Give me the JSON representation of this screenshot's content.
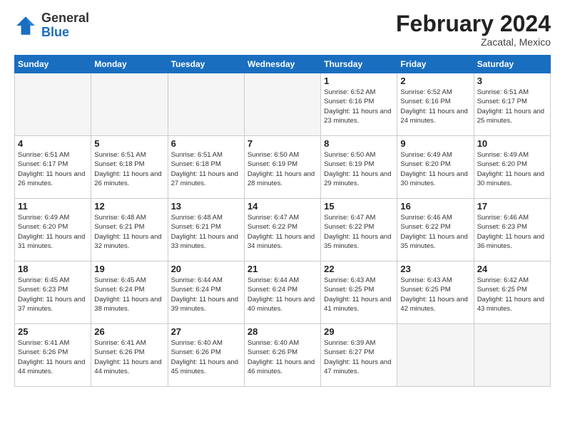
{
  "header": {
    "logo_general": "General",
    "logo_blue": "Blue",
    "month_year": "February 2024",
    "location": "Zacatal, Mexico"
  },
  "weekdays": [
    "Sunday",
    "Monday",
    "Tuesday",
    "Wednesday",
    "Thursday",
    "Friday",
    "Saturday"
  ],
  "weeks": [
    [
      {
        "day": "",
        "empty": true
      },
      {
        "day": "",
        "empty": true
      },
      {
        "day": "",
        "empty": true
      },
      {
        "day": "",
        "empty": true
      },
      {
        "day": "1",
        "sunrise": "6:52 AM",
        "sunset": "6:16 PM",
        "daylight": "11 hours and 23 minutes."
      },
      {
        "day": "2",
        "sunrise": "6:52 AM",
        "sunset": "6:16 PM",
        "daylight": "11 hours and 24 minutes."
      },
      {
        "day": "3",
        "sunrise": "6:51 AM",
        "sunset": "6:17 PM",
        "daylight": "11 hours and 25 minutes."
      }
    ],
    [
      {
        "day": "4",
        "sunrise": "6:51 AM",
        "sunset": "6:17 PM",
        "daylight": "11 hours and 26 minutes."
      },
      {
        "day": "5",
        "sunrise": "6:51 AM",
        "sunset": "6:18 PM",
        "daylight": "11 hours and 26 minutes."
      },
      {
        "day": "6",
        "sunrise": "6:51 AM",
        "sunset": "6:18 PM",
        "daylight": "11 hours and 27 minutes."
      },
      {
        "day": "7",
        "sunrise": "6:50 AM",
        "sunset": "6:19 PM",
        "daylight": "11 hours and 28 minutes."
      },
      {
        "day": "8",
        "sunrise": "6:50 AM",
        "sunset": "6:19 PM",
        "daylight": "11 hours and 29 minutes."
      },
      {
        "day": "9",
        "sunrise": "6:49 AM",
        "sunset": "6:20 PM",
        "daylight": "11 hours and 30 minutes."
      },
      {
        "day": "10",
        "sunrise": "6:49 AM",
        "sunset": "6:20 PM",
        "daylight": "11 hours and 30 minutes."
      }
    ],
    [
      {
        "day": "11",
        "sunrise": "6:49 AM",
        "sunset": "6:20 PM",
        "daylight": "11 hours and 31 minutes."
      },
      {
        "day": "12",
        "sunrise": "6:48 AM",
        "sunset": "6:21 PM",
        "daylight": "11 hours and 32 minutes."
      },
      {
        "day": "13",
        "sunrise": "6:48 AM",
        "sunset": "6:21 PM",
        "daylight": "11 hours and 33 minutes."
      },
      {
        "day": "14",
        "sunrise": "6:47 AM",
        "sunset": "6:22 PM",
        "daylight": "11 hours and 34 minutes."
      },
      {
        "day": "15",
        "sunrise": "6:47 AM",
        "sunset": "6:22 PM",
        "daylight": "11 hours and 35 minutes."
      },
      {
        "day": "16",
        "sunrise": "6:46 AM",
        "sunset": "6:22 PM",
        "daylight": "11 hours and 35 minutes."
      },
      {
        "day": "17",
        "sunrise": "6:46 AM",
        "sunset": "6:23 PM",
        "daylight": "11 hours and 36 minutes."
      }
    ],
    [
      {
        "day": "18",
        "sunrise": "6:45 AM",
        "sunset": "6:23 PM",
        "daylight": "11 hours and 37 minutes."
      },
      {
        "day": "19",
        "sunrise": "6:45 AM",
        "sunset": "6:24 PM",
        "daylight": "11 hours and 38 minutes."
      },
      {
        "day": "20",
        "sunrise": "6:44 AM",
        "sunset": "6:24 PM",
        "daylight": "11 hours and 39 minutes."
      },
      {
        "day": "21",
        "sunrise": "6:44 AM",
        "sunset": "6:24 PM",
        "daylight": "11 hours and 40 minutes."
      },
      {
        "day": "22",
        "sunrise": "6:43 AM",
        "sunset": "6:25 PM",
        "daylight": "11 hours and 41 minutes."
      },
      {
        "day": "23",
        "sunrise": "6:43 AM",
        "sunset": "6:25 PM",
        "daylight": "11 hours and 42 minutes."
      },
      {
        "day": "24",
        "sunrise": "6:42 AM",
        "sunset": "6:25 PM",
        "daylight": "11 hours and 43 minutes."
      }
    ],
    [
      {
        "day": "25",
        "sunrise": "6:41 AM",
        "sunset": "6:26 PM",
        "daylight": "11 hours and 44 minutes."
      },
      {
        "day": "26",
        "sunrise": "6:41 AM",
        "sunset": "6:26 PM",
        "daylight": "11 hours and 44 minutes."
      },
      {
        "day": "27",
        "sunrise": "6:40 AM",
        "sunset": "6:26 PM",
        "daylight": "11 hours and 45 minutes."
      },
      {
        "day": "28",
        "sunrise": "6:40 AM",
        "sunset": "6:26 PM",
        "daylight": "11 hours and 46 minutes."
      },
      {
        "day": "29",
        "sunrise": "6:39 AM",
        "sunset": "6:27 PM",
        "daylight": "11 hours and 47 minutes."
      },
      {
        "day": "",
        "empty": true
      },
      {
        "day": "",
        "empty": true
      }
    ]
  ]
}
